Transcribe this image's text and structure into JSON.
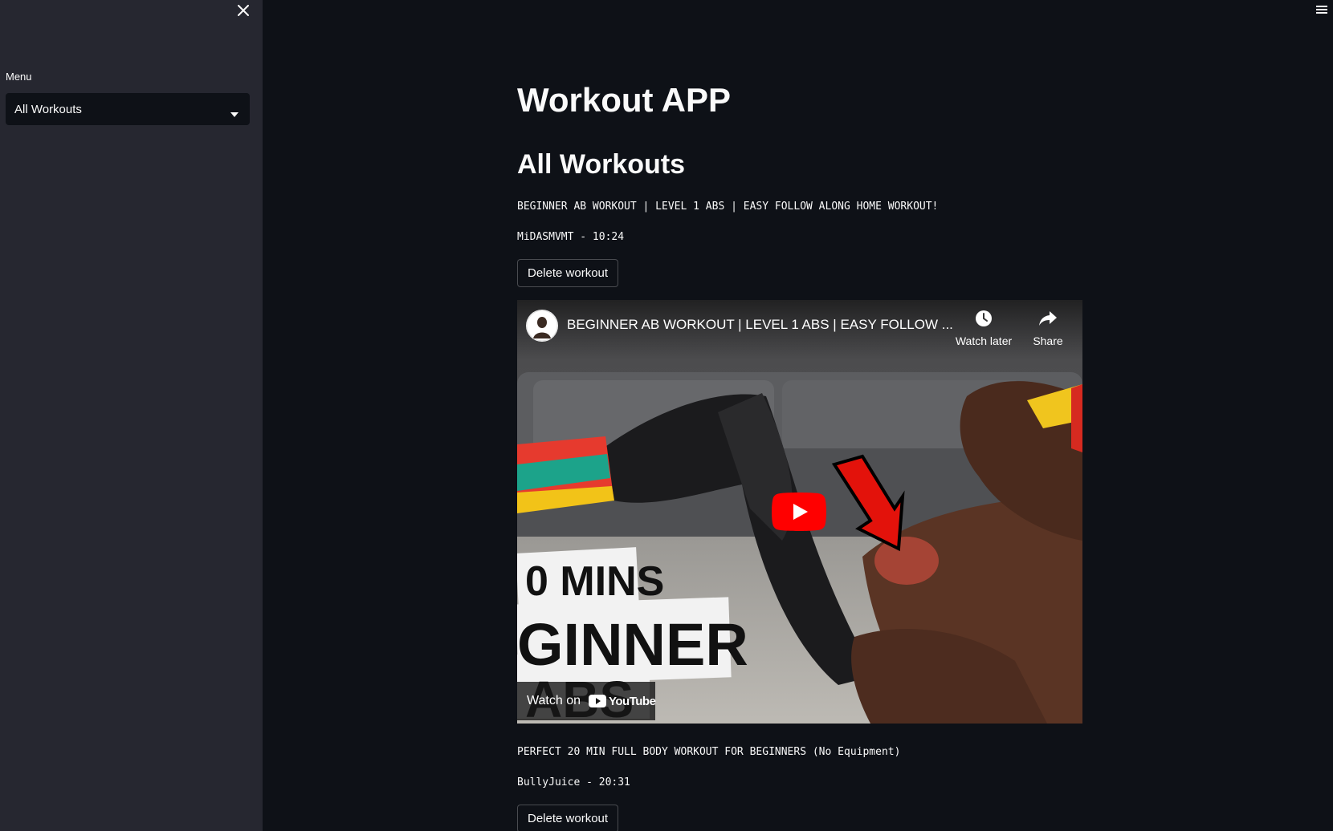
{
  "sidebar": {
    "close_icon": "close-icon",
    "menu_label": "Menu",
    "select_value": "All Workouts"
  },
  "header": {
    "menu_icon": "hamburger-icon"
  },
  "main": {
    "app_title": "Workout APP",
    "section_title": "All Workouts",
    "workouts": [
      {
        "title": "BEGINNER AB WORKOUT | LEVEL 1 ABS | EASY FOLLOW ALONG HOME WORKOUT!",
        "meta": "MiDASMVMT - 10:24",
        "delete_label": "Delete workout",
        "video": {
          "title": "BEGINNER AB WORKOUT | LEVEL 1 ABS | EASY FOLLOW ...",
          "watch_later_label": "Watch later",
          "share_label": "Share",
          "watch_on_label": "Watch on",
          "youtube_label": "YouTube",
          "thumbnail_text": [
            "0 MINS",
            "GINNER",
            "ABS"
          ]
        }
      },
      {
        "title": "PERFECT 20 MIN FULL BODY WORKOUT FOR BEGINNERS (No Equipment)",
        "meta": "BullyJuice - 20:31",
        "delete_label": "Delete workout"
      }
    ]
  },
  "colors": {
    "background": "#0e1117",
    "sidebar": "#262730",
    "text": "#fafafa",
    "youtube_red": "#ff0000"
  }
}
